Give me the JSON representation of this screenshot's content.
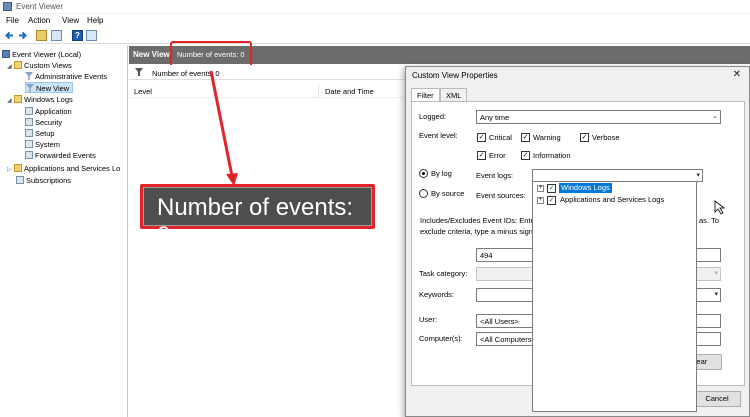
{
  "window": {
    "title": "Event Viewer"
  },
  "menu": [
    "File",
    "Action",
    "View",
    "Help"
  ],
  "tree": {
    "root": "Event Viewer (Local)",
    "custom_views": "Custom Views",
    "admin_events": "Administrative Events",
    "new_view": "New View",
    "windows_logs": "Windows Logs",
    "application": "Application",
    "security": "Security",
    "setup": "Setup",
    "system": "System",
    "forwarded_events": "Forwarded Events",
    "apps_services": "Applications and Services Lo",
    "subscriptions": "Subscriptions"
  },
  "main": {
    "view_name": "New View",
    "event_count": "Number of events: 0",
    "filter_count": "Number of events: 0",
    "col_level": "Level",
    "col_datetime": "Date and Time"
  },
  "callout": {
    "text": "Number of events: 0"
  },
  "dialog": {
    "title": "Custom View Properties",
    "close": "✕",
    "tab_filter": "Filter",
    "tab_xml": "XML",
    "logged_label": "Logged:",
    "logged_value": "Any time",
    "event_level_label": "Event level:",
    "critical": "Critical",
    "warning": "Warning",
    "verbose": "Verbose",
    "error": "Error",
    "information": "Information",
    "by_log": "By log",
    "by_source": "By source",
    "event_logs_label": "Event logs:",
    "event_sources_label": "Event sources:",
    "include_text_1": "Includes/Excludes Event IDs: Ente",
    "include_text_1b": "as. To",
    "include_text_2": "exclude criteria, type a minus sign",
    "event_id_value": "494",
    "task_category_label": "Task category:",
    "keywords_label": "Keywords:",
    "user_label": "User:",
    "user_value": "<All Users>",
    "computer_label": "Computer(s):",
    "computer_value": "<All Computers",
    "clear_btn": "lear",
    "cancel_btn": "Cancel",
    "log_tree": {
      "windows_logs": "Windows Logs",
      "apps_services_logs": "Applications and Services Logs"
    }
  },
  "colors": {
    "accent_red": "#e0242a",
    "header_gray": "#6c6c6c",
    "selection_blue": "#cce4f7",
    "highlight_blue": "#0078d7"
  }
}
